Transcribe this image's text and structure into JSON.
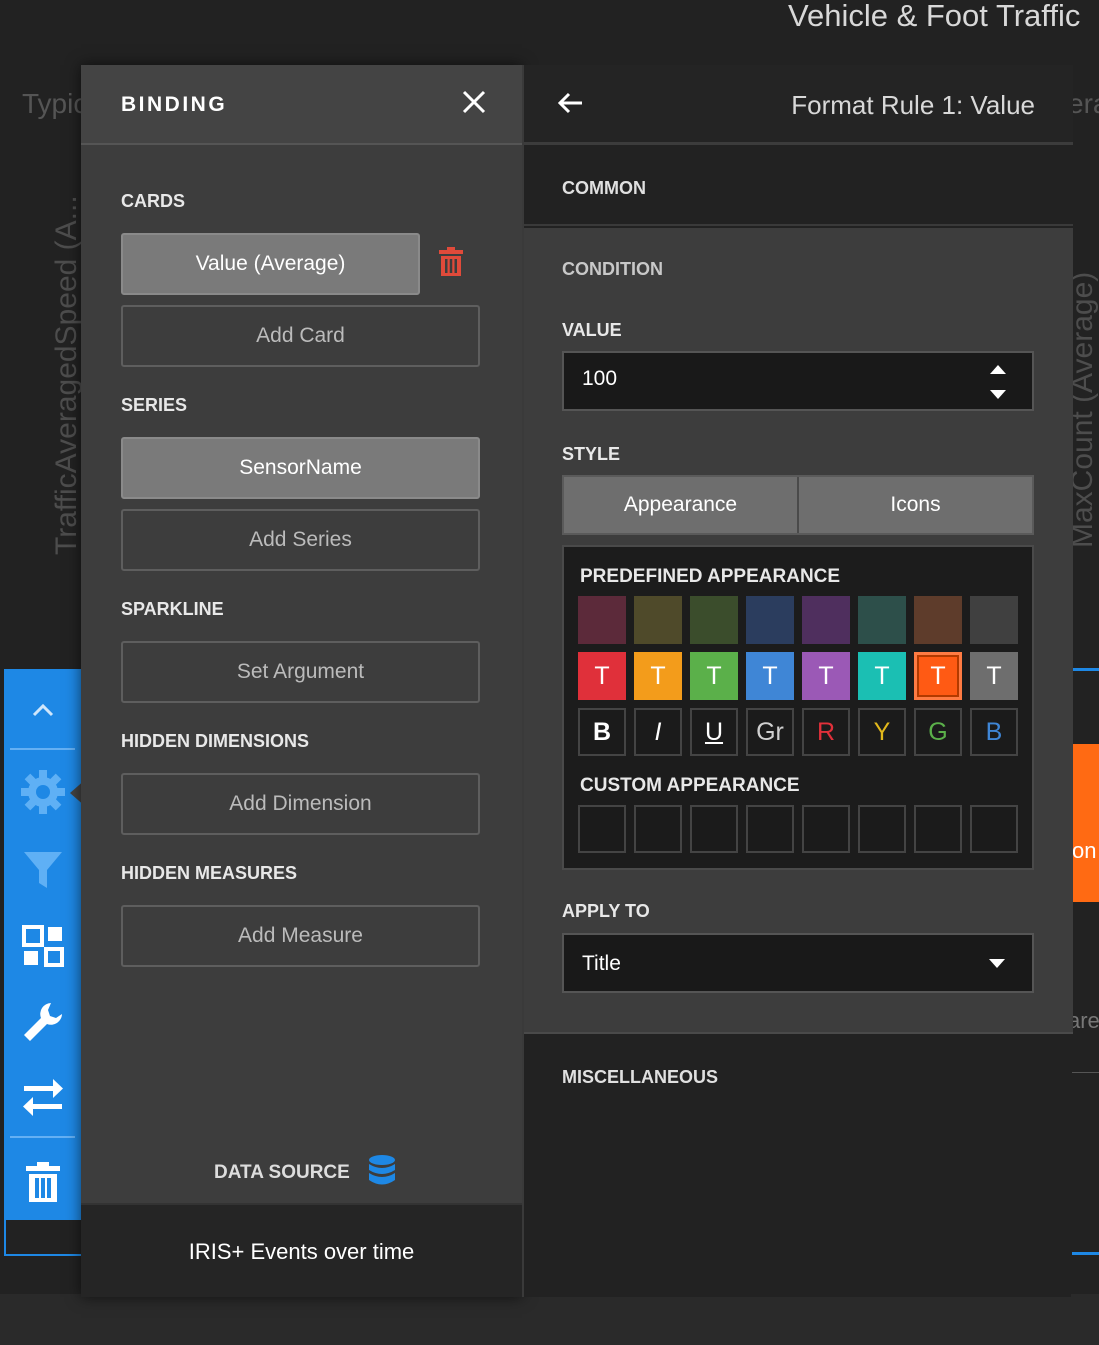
{
  "background": {
    "dashboard_title": "Vehicle & Foot Traffic",
    "left_fragment": "Typic",
    "y_axis_left": "TrafficAveragedSpeed (A...",
    "right_fragment": "era",
    "y_axis_right": "MaxCount (Average)",
    "orange_fragment": "on",
    "are_fragment": "are"
  },
  "toolbar": {
    "icons": [
      "chevron-up-icon",
      "gear-icon",
      "filter-icon",
      "widgets-icon",
      "wrench-icon",
      "swap-icon",
      "trash-icon"
    ]
  },
  "binding": {
    "title": "BINDING",
    "cards_label": "CARDS",
    "card_value": "Value (Average)",
    "add_card": "Add Card",
    "series_label": "SERIES",
    "series_value": "SensorName",
    "add_series": "Add Series",
    "sparkline_label": "SPARKLINE",
    "set_argument": "Set Argument",
    "hidden_dimensions_label": "HIDDEN DIMENSIONS",
    "add_dimension": "Add Dimension",
    "hidden_measures_label": "HIDDEN MEASURES",
    "add_measure": "Add Measure",
    "data_source_label": "DATA SOURCE",
    "data_source_name": "IRIS+ Events over time"
  },
  "format_rule": {
    "title": "Format Rule 1: Value",
    "common_label": "COMMON",
    "condition_label": "CONDITION",
    "value_label": "VALUE",
    "value": "100",
    "style_label": "STYLE",
    "style_tabs": [
      "Appearance",
      "Icons"
    ],
    "predefined_label": "PREDEFINED APPEARANCE",
    "background_swatches": [
      "#5c2a3a",
      "#4f4a2a",
      "#3b4d2c",
      "#2b3d5e",
      "#4f2f5e",
      "#2d4f4a",
      "#5e3c2b",
      "#404040"
    ],
    "text_swatches": [
      {
        "letter": "T",
        "color": "#e0303a"
      },
      {
        "letter": "T",
        "color": "#f39c1b"
      },
      {
        "letter": "T",
        "color": "#5bb04a"
      },
      {
        "letter": "T",
        "color": "#3f86d6"
      },
      {
        "letter": "T",
        "color": "#9b59b6"
      },
      {
        "letter": "T",
        "color": "#1bbfb3"
      },
      {
        "letter": "T",
        "color": "#ff5a14"
      },
      {
        "letter": "T",
        "color": "#6e6e6e"
      }
    ],
    "font_swatches": [
      {
        "letter": "B",
        "color": "#ffffff"
      },
      {
        "letter": "I",
        "color": "#ffffff"
      },
      {
        "letter": "U",
        "color": "#ffffff"
      },
      {
        "letter": "Gr",
        "color": "#d0d0d0"
      },
      {
        "letter": "R",
        "color": "#e0303a"
      },
      {
        "letter": "Y",
        "color": "#e2b81b"
      },
      {
        "letter": "G",
        "color": "#5bb04a"
      },
      {
        "letter": "B",
        "color": "#3f86d6"
      }
    ],
    "selected_text_swatch": 6,
    "custom_label": "CUSTOM APPEARANCE",
    "apply_to_label": "APPLY TO",
    "apply_to_value": "Title",
    "misc_label": "MISCELLANEOUS"
  }
}
